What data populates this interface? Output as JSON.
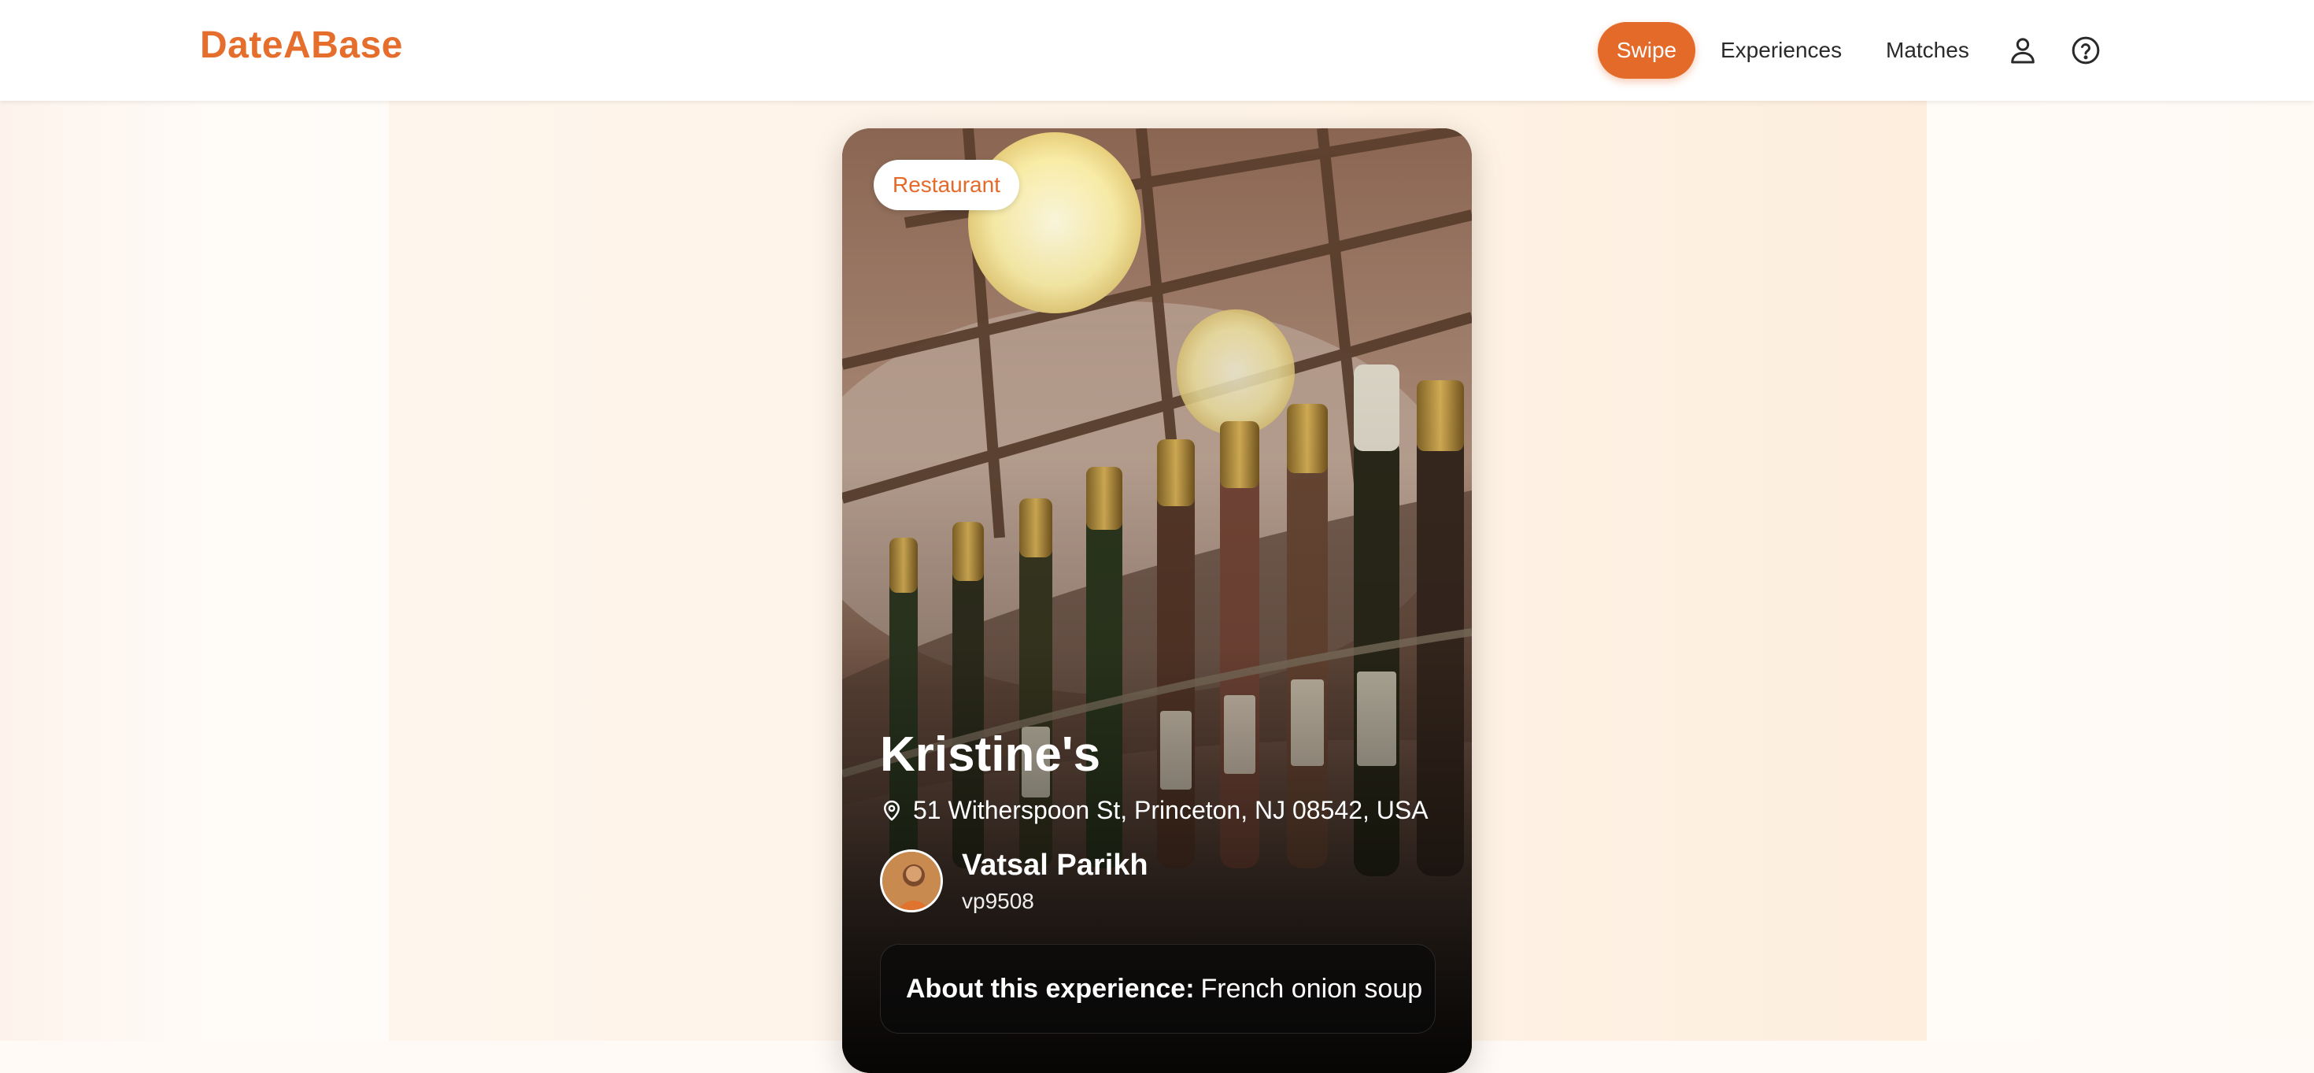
{
  "app": {
    "logo": "DateABase"
  },
  "nav": {
    "swipe": "Swipe",
    "experiences": "Experiences",
    "matches": "Matches",
    "profile_icon": "user-icon",
    "help_icon": "help-circle-icon"
  },
  "card": {
    "category": "Restaurant",
    "title": "Kristine's",
    "address": "51 Witherspoon St, Princeton, NJ 08542, USA",
    "host": {
      "name": "Vatsal Parikh",
      "handle": "vp9508"
    },
    "about_label": "About this experience:",
    "about_text": "French onion soup"
  },
  "colors": {
    "accent": "#e46a2a",
    "logo": "#e56e2c"
  }
}
